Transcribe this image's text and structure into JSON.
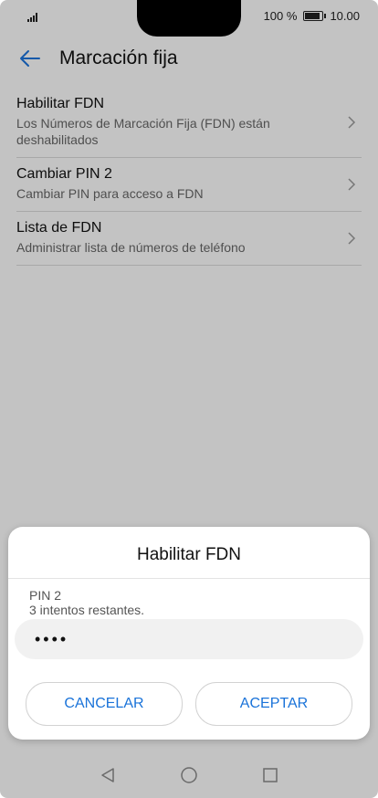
{
  "status": {
    "battery_text": "100 %",
    "time": "10.00"
  },
  "appbar": {
    "title": "Marcación fija"
  },
  "list": [
    {
      "title": "Habilitar FDN",
      "subtitle": "Los Números de Marcación Fija (FDN) están deshabilitados"
    },
    {
      "title": "Cambiar PIN 2",
      "subtitle": "Cambiar PIN para acceso a FDN"
    },
    {
      "title": "Lista de FDN",
      "subtitle": "Administrar lista de números de teléfono"
    }
  ],
  "dialog": {
    "title": "Habilitar FDN",
    "pin_label": "PIN 2",
    "attempts": "3 intentos restantes.",
    "pin_value": "••••",
    "cancel_label": "CANCELAR",
    "ok_label": "ACEPTAR"
  },
  "colors": {
    "accent": "#1a73d9"
  },
  "icons": {
    "back": "arrow-left-icon",
    "chevron": "chevron-right-icon",
    "signal": "signal-icon",
    "battery": "battery-icon"
  }
}
